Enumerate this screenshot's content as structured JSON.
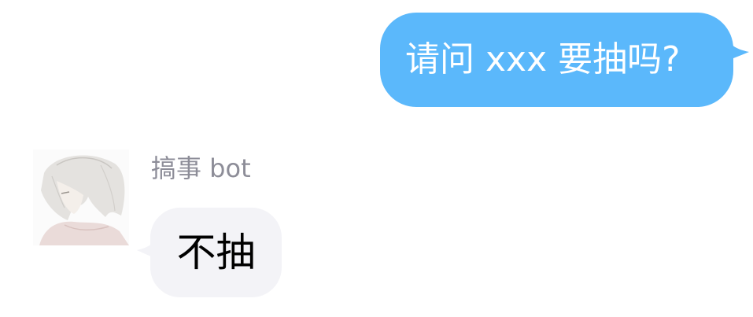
{
  "colors": {
    "outgoing_bubble": "#5bb8fb",
    "incoming_bubble": "#f3f3f7",
    "sender_name": "#8d8d98"
  },
  "outgoing": {
    "text": "请问 xxx 要抽吗?"
  },
  "incoming": {
    "avatar_icon": "anime-character-avatar",
    "sender": "搞事 bot",
    "text": "不抽"
  }
}
